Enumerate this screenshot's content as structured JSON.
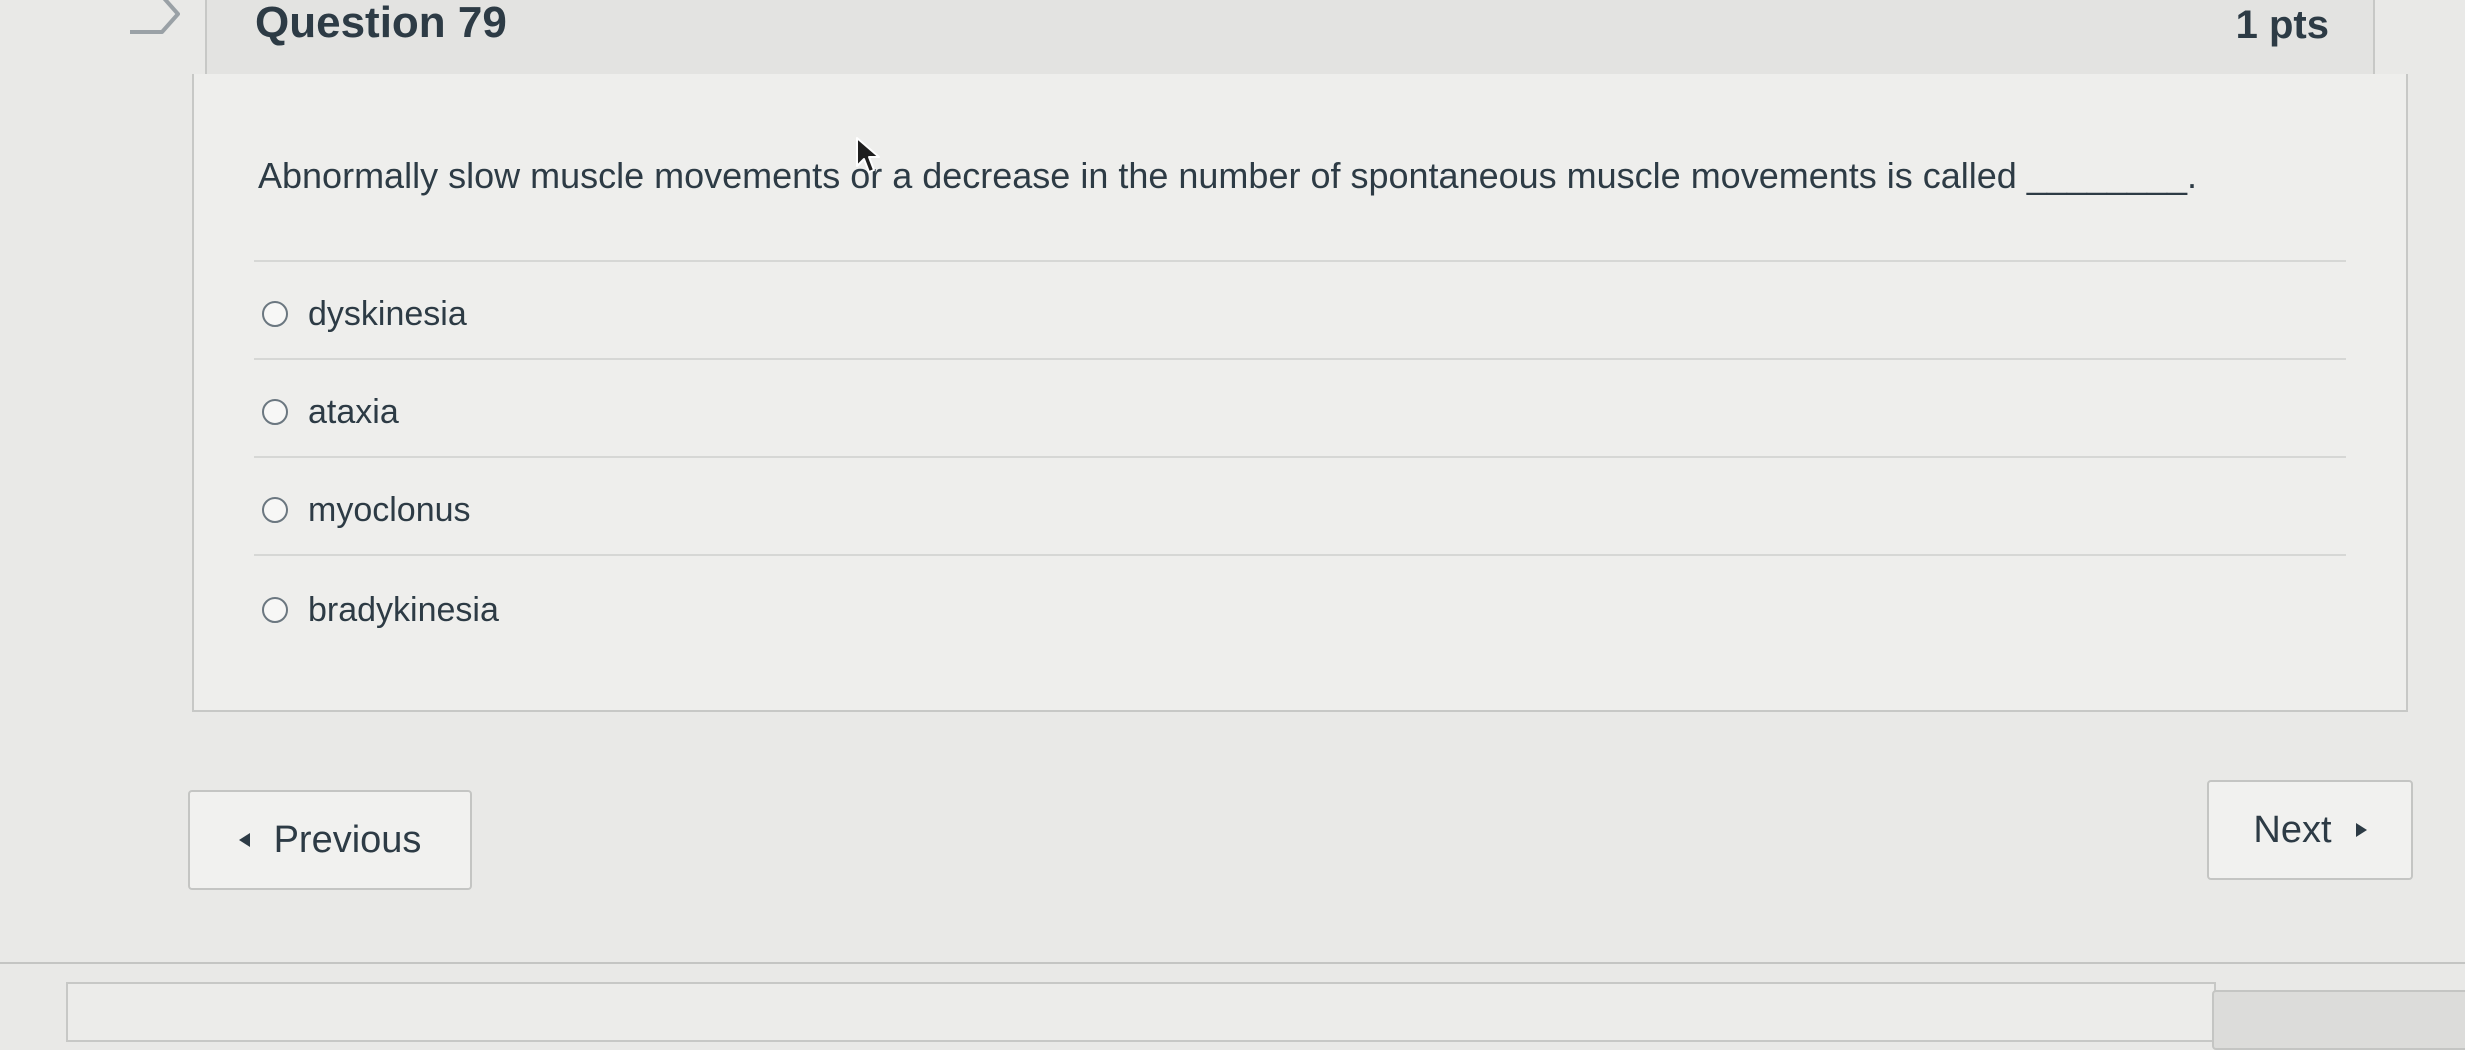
{
  "question": {
    "title": "Question 79",
    "points": "1 pts",
    "text": "Abnormally slow muscle movements or a decrease in the number of spontaneous muscle movements is called ________."
  },
  "answers": [
    {
      "label": "dyskinesia",
      "selected": false
    },
    {
      "label": "ataxia",
      "selected": false
    },
    {
      "label": "myoclonus",
      "selected": false
    },
    {
      "label": "bradykinesia",
      "selected": false
    }
  ],
  "navigation": {
    "previous_label": "Previous",
    "next_label": "Next"
  },
  "icons": {
    "bookmark": "bookmark-icon",
    "previous": "triangle-left-icon",
    "next": "triangle-right-icon",
    "cursor": "mouse-pointer-icon"
  },
  "colors": {
    "text": "#2d3b45",
    "background": "#e9e9e7",
    "border": "#c7c8c6"
  }
}
